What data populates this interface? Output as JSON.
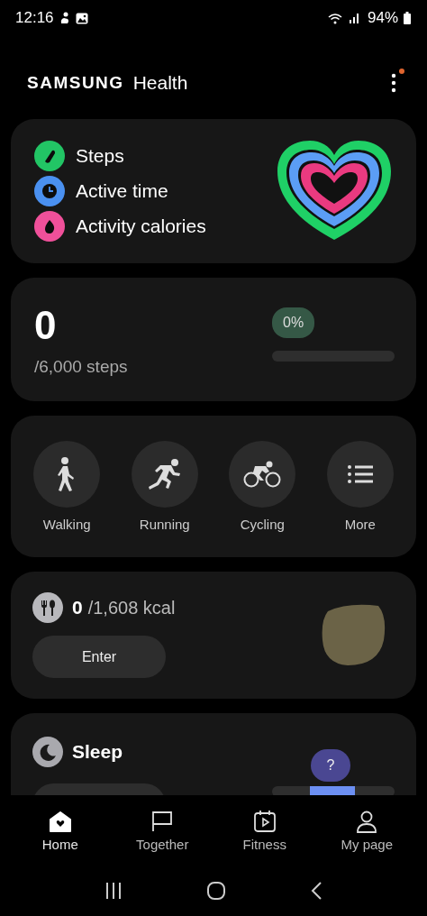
{
  "status_bar": {
    "time": "12:16",
    "battery": "94%"
  },
  "header": {
    "brand": "SAMSUNG",
    "title": "Health",
    "menu_badge": true
  },
  "activity_card": {
    "items": [
      {
        "kind": "steps",
        "label": "Steps",
        "color": "#22c565"
      },
      {
        "kind": "time",
        "label": "Active time",
        "color": "#4a90f0"
      },
      {
        "kind": "calories",
        "label": "Activity calories",
        "color": "#f0509a"
      }
    ]
  },
  "steps_card": {
    "count": "0",
    "goal": "/6,000 steps",
    "percent": "0%",
    "level": 0
  },
  "workouts": [
    {
      "kind": "walking",
      "label": "Walking"
    },
    {
      "kind": "running",
      "label": "Running"
    },
    {
      "kind": "cycling",
      "label": "Cycling"
    },
    {
      "kind": "more",
      "label": "More"
    }
  ],
  "food_card": {
    "count": "0",
    "goal": "/1,608 kcal",
    "button": "Enter"
  },
  "sleep_card": {
    "title": "Sleep",
    "hint": "?"
  },
  "tabs": [
    {
      "kind": "home",
      "label": "Home",
      "selected": true
    },
    {
      "kind": "together",
      "label": "Together",
      "selected": false
    },
    {
      "kind": "fitness",
      "label": "Fitness",
      "selected": false
    },
    {
      "kind": "mypage",
      "label": "My page",
      "selected": false
    }
  ]
}
